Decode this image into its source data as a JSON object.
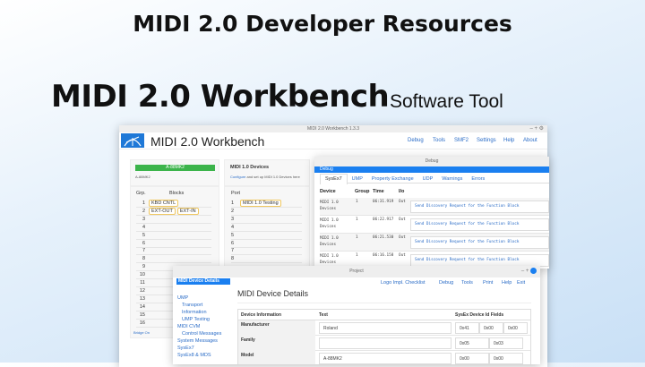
{
  "banner": {
    "title": "MIDI 2.0 Developer Resources",
    "product": "MIDI 2.0 Workbench",
    "subtitle": "Software Tool"
  },
  "main_window": {
    "window_title": "MIDI 2.0 Workbench 1.3.3",
    "app_title": "MIDI 2.0 Workbench",
    "menu": [
      "Debug",
      "Tools",
      "SMF2",
      "Settings",
      "Help",
      "About"
    ],
    "device": {
      "badge": "A-88MK2",
      "name": "A-88MK2",
      "badge_color": "#3cb44b",
      "col_group": "Grp.",
      "col_blocks": "Blocks",
      "groups": [
        {
          "n": "1",
          "blocks": [
            "KBD CNTL"
          ]
        },
        {
          "n": "2",
          "blocks": [
            "EXT-OUT",
            "EXT-IN"
          ]
        },
        {
          "n": "3",
          "blocks": []
        },
        {
          "n": "4",
          "blocks": []
        },
        {
          "n": "5",
          "blocks": []
        },
        {
          "n": "6",
          "blocks": []
        },
        {
          "n": "7",
          "blocks": []
        },
        {
          "n": "8",
          "blocks": []
        },
        {
          "n": "9",
          "blocks": []
        },
        {
          "n": "10",
          "blocks": []
        },
        {
          "n": "11",
          "blocks": []
        },
        {
          "n": "12",
          "blocks": []
        },
        {
          "n": "13",
          "blocks": []
        },
        {
          "n": "14",
          "blocks": []
        },
        {
          "n": "15",
          "blocks": []
        },
        {
          "n": "16",
          "blocks": []
        }
      ],
      "footer_link": "Bridge On"
    },
    "midi1": {
      "title": "MIDI 1.0 Devices",
      "configure_link": "Configure",
      "desc": "and set up MIDI 1.0 Devices here",
      "col_port": "Port",
      "ports": [
        {
          "n": "1",
          "name": "MIDI 1.0 Testing"
        },
        {
          "n": "2",
          "name": ""
        },
        {
          "n": "3",
          "name": ""
        },
        {
          "n": "4",
          "name": ""
        },
        {
          "n": "5",
          "name": ""
        },
        {
          "n": "6",
          "name": ""
        },
        {
          "n": "7",
          "name": ""
        },
        {
          "n": "8",
          "name": ""
        }
      ]
    }
  },
  "debug_window": {
    "window_title": "Debug",
    "panel_title": "Debug",
    "tabs": [
      "SysEx7",
      "UMP",
      "Property Exchange",
      "UDP",
      "Warnings",
      "Errors"
    ],
    "columns": [
      "Device",
      "Group",
      "Time",
      "I/o"
    ],
    "rows": [
      {
        "device": "MIDI 1.0 Devices",
        "group": "1",
        "time": "06:31.919",
        "io": "Out",
        "message": "Send Discovery Request for the Function Block"
      },
      {
        "device": "MIDI 1.0 Devices",
        "group": "1",
        "time": "06:22.917",
        "io": "Out",
        "message": "Send Discovery Request for the Function Block"
      },
      {
        "device": "MIDI 1.0 Devices",
        "group": "1",
        "time": "06:21.530",
        "io": "Out",
        "message": "Send Discovery Request for the Function Block"
      },
      {
        "device": "MIDI 1.0 Devices",
        "group": "1",
        "time": "06:16.158",
        "io": "Out",
        "message": "Send Discovery Request for the Function Block"
      }
    ]
  },
  "project_window": {
    "window_title": "Project",
    "sidebar_selected": "MIDI Device Details",
    "sidebar": [
      {
        "label": "UMP",
        "indent": 0
      },
      {
        "label": "Transport",
        "indent": 1
      },
      {
        "label": "Information",
        "indent": 1
      },
      {
        "label": "UMP Testing",
        "indent": 1
      },
      {
        "label": "MIDI CVM",
        "indent": 0
      },
      {
        "label": "Control Messages",
        "indent": 1
      },
      {
        "label": "System Messages",
        "indent": 0
      },
      {
        "label": "SysEx7",
        "indent": 0
      },
      {
        "label": "SysEx8 & MDS",
        "indent": 0
      }
    ],
    "menu": [
      "Logo Impl. Checklist",
      "Debug",
      "Tools",
      "Print",
      "Help",
      "Exit"
    ],
    "heading": "MIDI Device Details",
    "table": {
      "headers": [
        "Device Information",
        "Text",
        "SysEx Device Id Fields"
      ],
      "rows": [
        {
          "label": "Manufacturer",
          "text": "Roland",
          "ids": [
            "0x41",
            "0x00",
            "0x00"
          ]
        },
        {
          "label": "Family",
          "text": "",
          "ids": [
            "0x05",
            "0x03"
          ]
        },
        {
          "label": "Model",
          "text": "A-88MK2",
          "ids": [
            "0x00",
            "0x00"
          ]
        }
      ]
    }
  }
}
